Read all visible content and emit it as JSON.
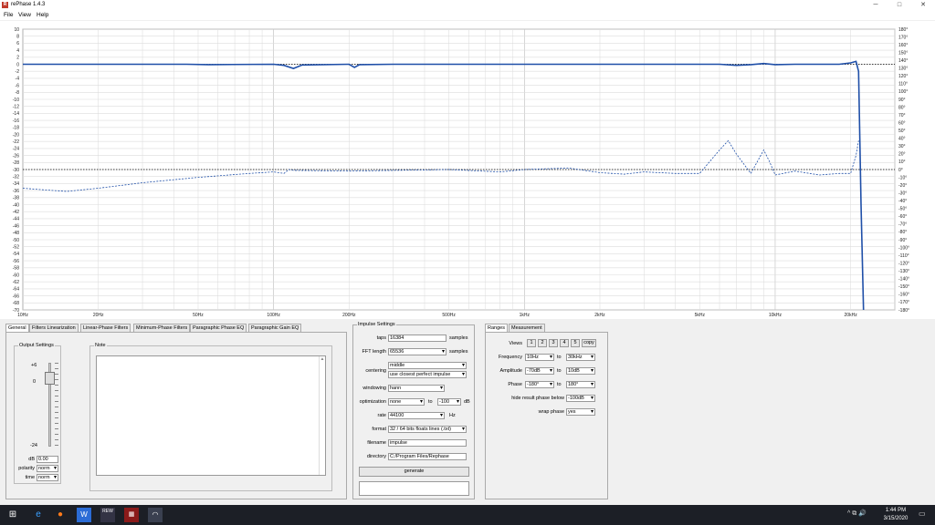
{
  "window": {
    "title": "rePhase 1.4.3",
    "app_icon": "rePhase-icon",
    "minimize": "─",
    "maximize": "□",
    "close": "✕"
  },
  "menu": [
    "File",
    "View",
    "Help"
  ],
  "chart_data": {
    "type": "line",
    "x_scale": "log",
    "xlim": [
      10,
      30000
    ],
    "ylim_left": [
      -70,
      10
    ],
    "ylim_right": [
      -180,
      180
    ],
    "x_ticks": [
      "10Hz",
      "20Hz",
      "50Hz",
      "100Hz",
      "200Hz",
      "500Hz",
      "1kHz",
      "2kHz",
      "5kHz",
      "10kHz",
      "20kHz"
    ],
    "x_tick_values": [
      10,
      20,
      50,
      100,
      200,
      500,
      1000,
      2000,
      5000,
      10000,
      20000
    ],
    "y_ticks_left": [
      "10",
      "8",
      "6",
      "4",
      "2",
      "0",
      "-2",
      "-4",
      "-6",
      "-8",
      "-10",
      "-12",
      "-14",
      "-16",
      "-18",
      "-20",
      "-22",
      "-24",
      "-26",
      "-28",
      "-30",
      "-32",
      "-34",
      "-36",
      "-38",
      "-40",
      "-42",
      "-44",
      "-46",
      "-48",
      "-50",
      "-52",
      "-54",
      "-56",
      "-58",
      "-60",
      "-62",
      "-64",
      "-66",
      "-68",
      "-70"
    ],
    "y_ticks_right": [
      "180°",
      "170°",
      "160°",
      "150°",
      "140°",
      "130°",
      "120°",
      "110°",
      "100°",
      "90°",
      "80°",
      "70°",
      "60°",
      "50°",
      "40°",
      "30°",
      "20°",
      "10°",
      "0°",
      "-10°",
      "-20°",
      "-30°",
      "-40°",
      "-50°",
      "-60°",
      "-70°",
      "-80°",
      "-90°",
      "-100°",
      "-110°",
      "-120°",
      "-130°",
      "-140°",
      "-150°",
      "-160°",
      "-170°",
      "-180°"
    ],
    "grid": true,
    "series": [
      {
        "role": "amplitude",
        "color": "#1f4fa8",
        "style": "solid",
        "x": [
          10,
          45,
          55,
          100,
          110,
          120,
          130,
          200,
          210,
          220,
          300,
          1000,
          5000,
          6000,
          7000,
          8000,
          9000,
          10000,
          12000,
          15000,
          18000,
          20000,
          21000,
          21500,
          22000,
          22500
        ],
        "y": [
          0,
          0,
          -0.1,
          0,
          -0.3,
          -1.2,
          -0.2,
          0,
          -0.9,
          -0.1,
          0,
          0,
          0,
          0,
          -0.3,
          -0.1,
          0.2,
          -0.1,
          0,
          0,
          0,
          0.4,
          0.8,
          -2,
          -40,
          -70
        ]
      },
      {
        "role": "phase",
        "color": "#1f4fa8",
        "style": "dashed",
        "x": [
          10,
          12,
          15,
          20,
          30,
          50,
          80,
          100,
          110,
          115,
          120,
          200,
          500,
          800,
          1000,
          1500,
          2000,
          2500,
          3000,
          4000,
          5000,
          6000,
          6500,
          7000,
          8000,
          9000,
          9500,
          10000,
          12000,
          15000,
          18000,
          20000,
          21000,
          21500
        ],
        "y": [
          -24,
          -26,
          -28,
          -24,
          -17,
          -10,
          -5,
          -3,
          -5,
          0,
          -1,
          -2,
          0,
          -3,
          0,
          2,
          -4,
          -6,
          -3,
          -5,
          -5,
          25,
          37,
          20,
          -5,
          25,
          10,
          -7,
          -2,
          -7,
          -5,
          -5,
          18,
          37
        ]
      }
    ]
  },
  "tabs": [
    "General",
    "Filters Linearization",
    "Linear-Phase Filters",
    "Minimum-Phase Filters",
    "Paragraphic Phase EQ",
    "Paragraphic Gain EQ"
  ],
  "output_settings": {
    "label": "Output Settings",
    "slider_top": "+6",
    "slider_zero": "0",
    "slider_bottom": "-24",
    "db_label": "dB",
    "db_value": "0.00",
    "polarity_label": "polarity",
    "polarity_value": "norm",
    "time_label": "time",
    "time_value": "norm"
  },
  "note": {
    "label": "Note",
    "text": ""
  },
  "impulse": {
    "label": "Impulse Settings",
    "taps_label": "taps",
    "taps_value": "16384",
    "taps_unit": "samples",
    "fft_label": "FFT length",
    "fft_value": "65536",
    "fft_unit": "samples",
    "centering_label": "centering",
    "centering_value1": "middle",
    "centering_value2": "use closest perfect impulse",
    "windowing_label": "windowing",
    "windowing_value": "hann",
    "optimization_label": "optimization",
    "optimization_value": "none",
    "optimization_to": "to",
    "optimization_db": "-100",
    "optimization_unit": "dB",
    "rate_label": "rate",
    "rate_value": "44100",
    "rate_unit": "Hz",
    "format_label": "format",
    "format_value": "32 / 64 bits floats lines (.txt)",
    "filename_label": "filename",
    "filename_value": "impulse",
    "directory_label": "directory",
    "directory_value": "C:/Program Files/Rephase",
    "generate": "generate"
  },
  "ranges": {
    "tab_ranges": "Ranges",
    "tab_measurement": "Measurement",
    "views_label": "Views",
    "views": [
      "1",
      "2",
      "3",
      "4",
      "5"
    ],
    "copy": "copy",
    "frequency_label": "Frequency",
    "freq_from": "10Hz",
    "freq_to": "30kHz",
    "amplitude_label": "Amplitude",
    "amp_from": "-70dB",
    "amp_to": "10dB",
    "phase_label": "Phase",
    "phase_from": "-180°",
    "phase_to": "180°",
    "to": "to",
    "hide_label": "hide result phase below",
    "hide_value": "-100dB",
    "wrap_label": "wrap phase",
    "wrap_value": "yes"
  },
  "taskbar": {
    "time": "1:44 PM",
    "date": "3/15/2020",
    "rew_label": "REW"
  }
}
